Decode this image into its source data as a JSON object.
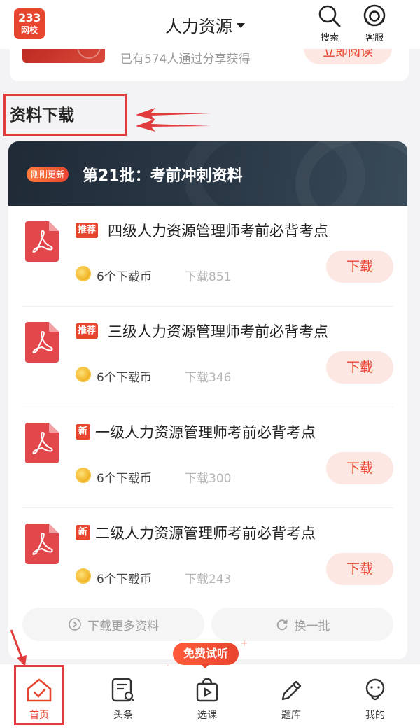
{
  "header": {
    "logo_top": "233",
    "logo_bottom": "网校",
    "title": "人力资源",
    "search_label": "搜索",
    "service_label": "客服"
  },
  "top_card": {
    "subtitle": "已有574人通过分享获得",
    "button_label": "立即阅读"
  },
  "section": {
    "title": "资料下载"
  },
  "banner": {
    "badge": "刚刚更新",
    "title": "第21批：考前冲刺资料"
  },
  "files": [
    {
      "tag": "推荐",
      "name": "四级人力资源管理师考前必背考点",
      "coins": "6个下载币",
      "downloads": "下载851",
      "button": "下载"
    },
    {
      "tag": "推荐",
      "name": "三级人力资源管理师考前必背考点",
      "coins": "6个下载币",
      "downloads": "下载346",
      "button": "下载"
    },
    {
      "tag": "新",
      "name": "一级人力资源管理师考前必背考点",
      "coins": "6个下载币",
      "downloads": "下载300",
      "button": "下载"
    },
    {
      "tag": "新",
      "name": "二级人力资源管理师考前必背考点",
      "coins": "6个下载币",
      "downloads": "下载243",
      "button": "下载"
    }
  ],
  "actions": {
    "more": "下载更多资料",
    "refresh": "换一批"
  },
  "trial_badge": "免费试听",
  "nav": {
    "items": [
      {
        "label": "首页",
        "icon": "home-icon",
        "active": true
      },
      {
        "label": "头条",
        "icon": "news-icon",
        "active": false
      },
      {
        "label": "选课",
        "icon": "course-bag-icon",
        "active": false
      },
      {
        "label": "题库",
        "icon": "pencil-icon",
        "active": false
      },
      {
        "label": "我的",
        "icon": "profile-icon",
        "active": false
      }
    ]
  },
  "colors": {
    "accent": "#e8452f",
    "accent_light": "#fde7e3",
    "annotation": "#e23b3b",
    "banner_dark": "#1f2a36"
  }
}
